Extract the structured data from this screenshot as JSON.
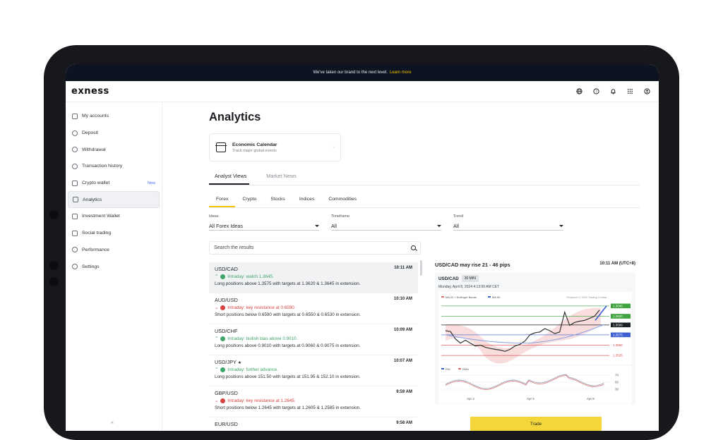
{
  "banner": {
    "text": "We've taken our brand to the next level.",
    "link": "Learn more"
  },
  "brand": "exness",
  "top_icons": [
    "globe-icon",
    "help-icon",
    "bell-icon",
    "apps-grid-icon",
    "user-icon"
  ],
  "sidebar": {
    "items": [
      {
        "label": "My accounts",
        "icon": "accounts-icon"
      },
      {
        "label": "Deposit",
        "icon": "deposit-icon"
      },
      {
        "label": "Withdrawal",
        "icon": "withdrawal-icon"
      },
      {
        "label": "Transaction history",
        "icon": "history-icon"
      },
      {
        "label": "Crypto wallet",
        "icon": "wallet-icon",
        "badge": "New"
      },
      {
        "label": "Analytics",
        "icon": "analytics-icon",
        "active": true
      },
      {
        "label": "Investment Wallet",
        "icon": "investment-icon"
      },
      {
        "label": "Social trading",
        "icon": "social-icon"
      },
      {
        "label": "Performance",
        "icon": "performance-icon"
      },
      {
        "label": "Settings",
        "icon": "settings-icon"
      }
    ],
    "collapse": "«"
  },
  "main": {
    "title": "Analytics",
    "econ": {
      "title": "Economic Calendar",
      "subtitle": "Track major global events"
    },
    "tabs": [
      {
        "label": "Analyst Views",
        "active": true
      },
      {
        "label": "Market News"
      }
    ],
    "subtabs": [
      {
        "label": "Forex",
        "active": true
      },
      {
        "label": "Crypto"
      },
      {
        "label": "Stocks"
      },
      {
        "label": "Indices"
      },
      {
        "label": "Commodities"
      }
    ],
    "filters": [
      {
        "label": "Ideas",
        "value": "All Forex Ideas"
      },
      {
        "label": "Timeframe",
        "value": "All"
      },
      {
        "label": "Trend",
        "value": "All"
      }
    ],
    "search_placeholder": "Search the results",
    "ideas": [
      {
        "pair": "USD/CAD",
        "time": "10:11 AM",
        "dir": "up",
        "headline": "Intraday: watch 1.3645.",
        "desc": "Long positions above 1.3575 with targets at 1.3620 & 1.3645 in extension."
      },
      {
        "pair": "AUD/USD",
        "time": "10:10 AM",
        "dir": "down",
        "headline": "Intraday: key resistance at 0.6590.",
        "desc": "Short positions below 0.6590 with targets at 0.6550 & 0.6530 in extension."
      },
      {
        "pair": "USD/CHF",
        "time": "10:09 AM",
        "dir": "up",
        "headline": "Intraday: bullish bias above 0.9010.",
        "desc": "Long positions above 0.9010 with targets at 0.9060 & 0.9075 in extension."
      },
      {
        "pair": "USD/JPY",
        "star": "★",
        "time": "10:07 AM",
        "dir": "up",
        "headline": "Intraday: further advance.",
        "desc": "Long positions above 151.50 with targets at 151.95 & 152.10 in extension."
      },
      {
        "pair": "GBP/USD",
        "time": "9:59 AM",
        "dir": "down",
        "headline": "Intraday: key resistance at 1.2645.",
        "desc": "Short positions below 1.2645 with targets at 1.2605 & 1.2585 in extension."
      },
      {
        "pair": "EUR/USD",
        "time": "9:58 AM",
        "dir": "up",
        "headline": "",
        "desc": ""
      }
    ]
  },
  "detail": {
    "title": "USD/CAD may rise 21 - 46 pips",
    "time": "10:11 AM (UTC+8)",
    "symbol": "USD/CAD",
    "interval": "30 MIN",
    "date": "Monday, April 8, 2024 4:13:00 AM CET",
    "legend": [
      "MA 20 + Bollinger Bands",
      "MA 50"
    ],
    "credit": "Research © 2024 Trading Central",
    "levels": [
      {
        "label": "1.3645",
        "color": "#3fa33f"
      },
      {
        "label": "1.3620",
        "color": "#3fa33f"
      },
      {
        "label": "1.3599",
        "color": "#1c1f26"
      },
      {
        "label": "1.3575",
        "color": "#3d5fd0"
      },
      {
        "label": "1.3550",
        "color": "#d7433f"
      },
      {
        "label": "1.3525",
        "color": "#d7433f"
      }
    ],
    "rsi_legend": [
      "RSI",
      "RMA"
    ],
    "rsi_levels": [
      "70",
      "50",
      "30"
    ],
    "xdates": [
      "Apr 4",
      "Apr 5",
      "Apr 8"
    ],
    "trade": "Trade"
  },
  "chart_data": {
    "type": "line",
    "series": [
      {
        "values": [
          1.3585,
          1.3583,
          1.3565,
          1.3555,
          1.3562,
          1.3555,
          1.3548,
          1.355,
          1.3545,
          1.3542,
          1.354,
          1.3538,
          1.3535,
          1.354,
          1.3548,
          1.3552,
          1.356,
          1.3575,
          1.358,
          1.3582,
          1.359,
          1.3585,
          1.3578,
          1.3582,
          1.363,
          1.3598,
          1.3605,
          1.3608,
          1.361,
          1.3615,
          1.362,
          1.3635
        ]
      }
    ],
    "ylim": [
      1.3515,
      1.3655
    ]
  }
}
